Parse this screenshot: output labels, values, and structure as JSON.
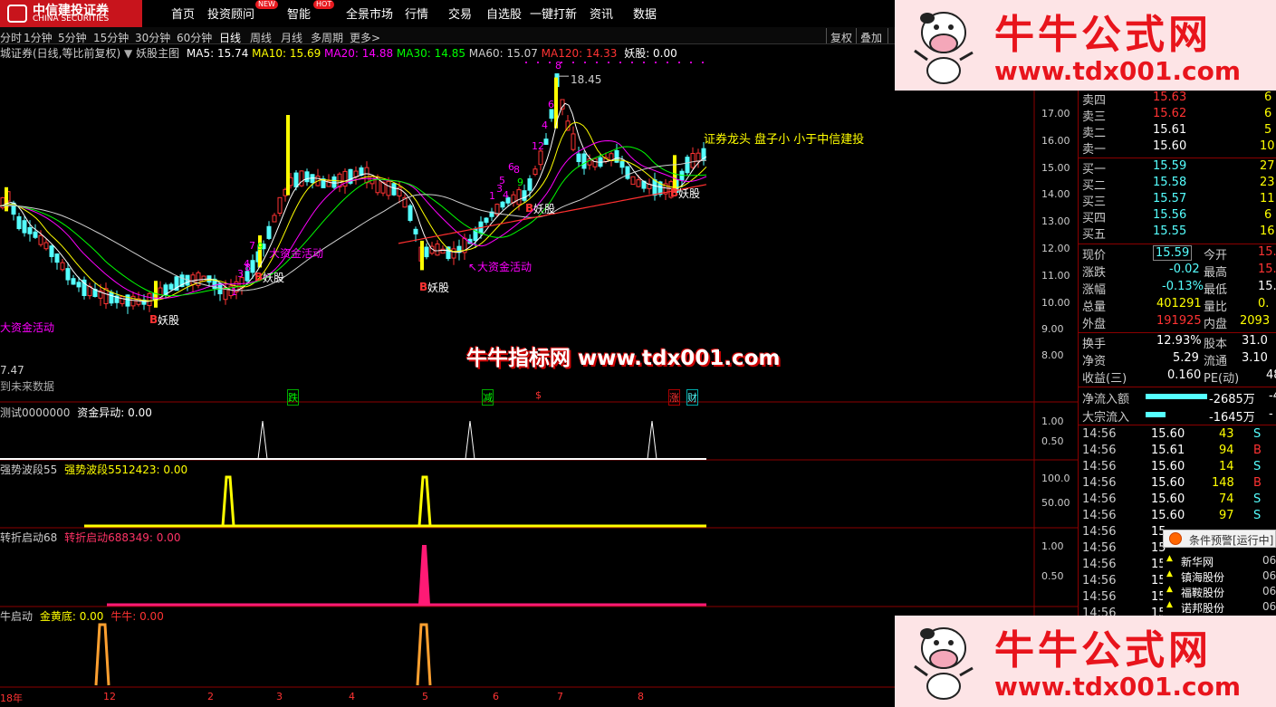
{
  "logo": {
    "cn": "中信建投证券",
    "en": "CHINA SECURITIES"
  },
  "menu": [
    {
      "label": "首页"
    },
    {
      "label": "投资顾问",
      "badge": "NEW"
    },
    {
      "label": "智能",
      "badge": "HOT"
    },
    {
      "label": "全景市场"
    },
    {
      "label": "行情"
    },
    {
      "label": "交易"
    },
    {
      "label": "自选股"
    },
    {
      "label": "一键打新"
    },
    {
      "label": "资讯"
    },
    {
      "label": "数据"
    }
  ],
  "periods": [
    "分时",
    "1分钟",
    "5分钟",
    "15分钟",
    "30分钟",
    "60分钟",
    "日线",
    "周线",
    "月线",
    "多周期",
    "更多>"
  ],
  "period_active": "日线",
  "toolbar_right": [
    "复权",
    "叠加"
  ],
  "info": {
    "stock": "城证券(日线,等比前复权)",
    "indicator": "妖股主图",
    "ma5": "MA5: 15.74",
    "ma10": "MA10: 15.69",
    "ma20": "MA20: 14.88",
    "ma30": "MA30: 14.85",
    "ma60": "MA60: 15.07",
    "ma120": "MA120: 14.33",
    "yg": "妖股: 0.00"
  },
  "colors": {
    "up": "#ff3333",
    "down": "#54ffff",
    "ma5": "#ffffff",
    "ma10": "#ffff00",
    "ma20": "#ff00ff",
    "ma30": "#00ff00",
    "ma60": "#d0d0d0",
    "ma120": "#ff3030",
    "accent": "#c8141c"
  },
  "main_chart": {
    "high_label": "18.45",
    "low_label": "7.47",
    "future_label": "到未来数据",
    "y_ticks": [
      "17.00",
      "16.00",
      "15.00",
      "14.00",
      "13.00",
      "12.00",
      "11.00",
      "10.00",
      "9.00",
      "8.00"
    ],
    "annotations": {
      "a1": "大资金活动",
      "a2": "大资金活动",
      "a3": "↖大资金活动",
      "y1": "妖股",
      "y2": "妖股",
      "y3": "妖股",
      "y4": "妖股",
      "y5": "妖股",
      "b": "B",
      "note": "证券龙头    盘子小    小于中信建投"
    },
    "counts": [
      "1",
      "3",
      "4",
      "7",
      "8",
      "9",
      "1",
      "3",
      "4",
      "5",
      "6",
      "8",
      "9",
      "12",
      "4",
      "6",
      "8"
    ],
    "events": [
      "跌",
      "减",
      "$",
      "涨",
      "财"
    ]
  },
  "panel1": {
    "title": "测试0000000",
    "label": "资金异动: 0.00",
    "ticks": [
      "1.00",
      "0.50"
    ]
  },
  "panel2": {
    "title": "强势波段55",
    "label": "强势波段5512423: 0.00",
    "ticks": [
      "100.0",
      "50.00"
    ]
  },
  "panel3": {
    "title": "转折启动68",
    "label": "转折启动688349: 0.00",
    "ticks": [
      "1.00",
      "0.50"
    ]
  },
  "panel4": {
    "title": "牛启动",
    "label1": "金黄底: 0.00",
    "label2": "牛牛: 0.00"
  },
  "x_axis": [
    "18年",
    "12",
    "2",
    "3",
    "4",
    "5",
    "6",
    "7",
    "8"
  ],
  "watermark": {
    "top": "牛牛公式网",
    "url": "www.tdx001.com",
    "center": "牛牛指标网 www.tdx001.com"
  },
  "quote": {
    "asks": [
      {
        "label": "卖四",
        "price": "15.63",
        "vol": "6"
      },
      {
        "label": "卖三",
        "price": "15.62",
        "vol": "6"
      },
      {
        "label": "卖二",
        "price": "15.61",
        "vol": "5"
      },
      {
        "label": "卖一",
        "price": "15.60",
        "vol": "10"
      }
    ],
    "bids": [
      {
        "label": "买一",
        "price": "15.59",
        "vol": "27"
      },
      {
        "label": "买二",
        "price": "15.58",
        "vol": "23"
      },
      {
        "label": "买三",
        "price": "15.57",
        "vol": "11"
      },
      {
        "label": "买四",
        "price": "15.56",
        "vol": "6"
      },
      {
        "label": "买五",
        "price": "15.55",
        "vol": "16"
      }
    ],
    "stats": [
      {
        "l1": "现价",
        "v1": "15.59",
        "l2": "今开",
        "v2": "15."
      },
      {
        "l1": "涨跌",
        "v1": "-0.02",
        "l2": "最高",
        "v2": "15."
      },
      {
        "l1": "涨幅",
        "v1": "-0.13%",
        "l2": "最低",
        "v2": "15."
      },
      {
        "l1": "总量",
        "v1": "401291",
        "l2": "量比",
        "v2": "0."
      },
      {
        "l1": "外盘",
        "v1": "191925",
        "l2": "内盘",
        "v2": "2093"
      }
    ],
    "fund": [
      {
        "l1": "换手",
        "v1": "12.93%",
        "l2": "股本",
        "v2": "31.0"
      },
      {
        "l1": "净资",
        "v1": "5.29",
        "l2": "流通",
        "v2": "3.10"
      },
      {
        "l1": "收益(三)",
        "v1": "0.160",
        "l2": "PE(动)",
        "v2": "48"
      }
    ],
    "flow": [
      {
        "label": "净流入额",
        "value": "-2685万",
        "tail": "-4"
      },
      {
        "label": "大宗流入",
        "value": "-1645万",
        "tail": "-"
      }
    ],
    "ticks": [
      {
        "t": "14:56",
        "p": "15.60",
        "v": "43",
        "s": "S"
      },
      {
        "t": "14:56",
        "p": "15.61",
        "v": "94",
        "s": "B"
      },
      {
        "t": "14:56",
        "p": "15.60",
        "v": "14",
        "s": "S"
      },
      {
        "t": "14:56",
        "p": "15.60",
        "v": "148",
        "s": "B"
      },
      {
        "t": "14:56",
        "p": "15.60",
        "v": "74",
        "s": "S"
      },
      {
        "t": "14:56",
        "p": "15.60",
        "v": "97",
        "s": "S"
      },
      {
        "t": "14:56",
        "p": "15",
        "v": "",
        "s": ""
      },
      {
        "t": "14:56",
        "p": "15",
        "v": "",
        "s": ""
      },
      {
        "t": "14:56",
        "p": "15",
        "v": "",
        "s": ""
      },
      {
        "t": "14:56",
        "p": "15",
        "v": "",
        "s": ""
      },
      {
        "t": "14:56",
        "p": "15",
        "v": "",
        "s": ""
      },
      {
        "t": "14:56",
        "p": "15",
        "v": "",
        "s": ""
      }
    ]
  },
  "alert": {
    "title": "条件预警[运行中]",
    "items": [
      {
        "name": "新华网",
        "val": "06"
      },
      {
        "name": "镇海股份",
        "val": "06"
      },
      {
        "name": "福鞍股份",
        "val": "06"
      },
      {
        "name": "诺邦股份",
        "val": "06"
      }
    ]
  }
}
